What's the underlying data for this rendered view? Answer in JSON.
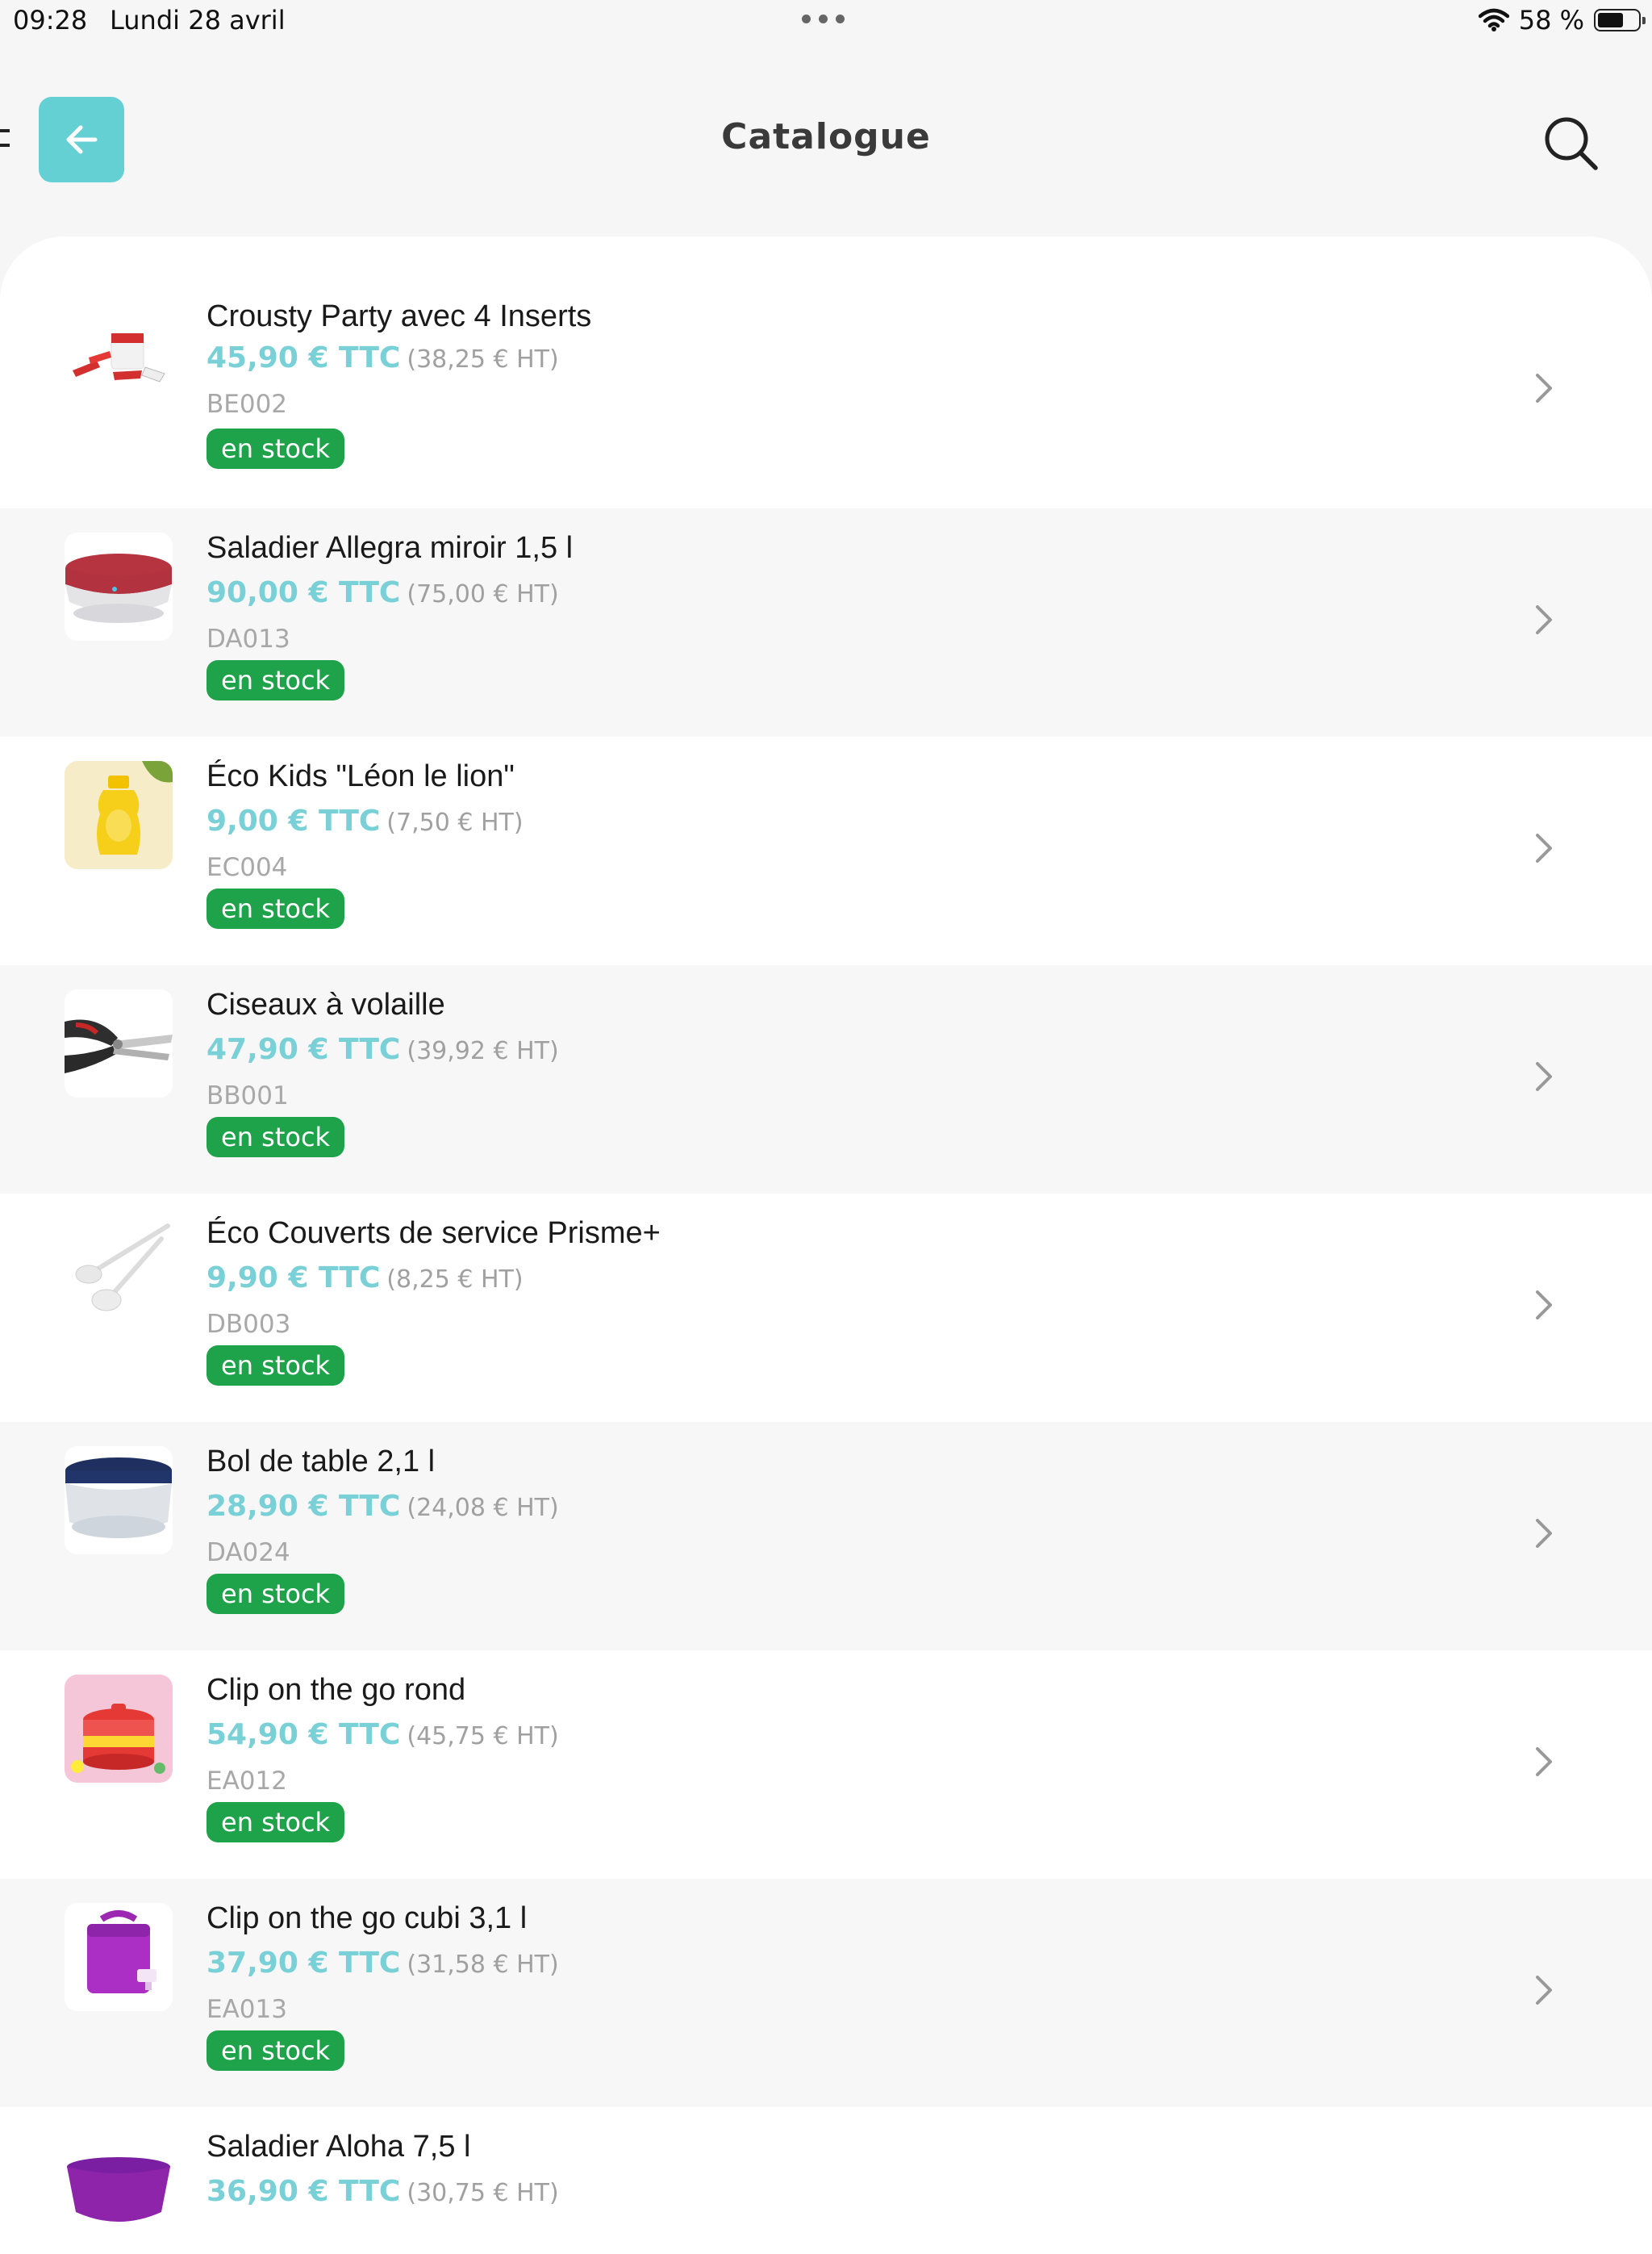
{
  "status_bar": {
    "time": "09:28",
    "date": "Lundi 28 avril",
    "battery_text": "58 %",
    "battery_level_percent": 58
  },
  "header": {
    "title": "Catalogue",
    "back_icon": "arrow-left-icon",
    "search_icon": "search-icon"
  },
  "colors": {
    "accent": "#65d0d4",
    "price": "#79d0d6",
    "stock_badge": "#1fa34a"
  },
  "products": [
    {
      "name": "Crousty Party avec 4 Inserts",
      "price_ttc": "45,90 € TTC",
      "price_ht": "(38,25 € HT)",
      "ref": "BE002",
      "stock": "en stock",
      "thumb_icon": "crousty-party-icon"
    },
    {
      "name": "Saladier Allegra miroir 1,5 l",
      "price_ttc": "90,00 € TTC",
      "price_ht": "(75,00 € HT)",
      "ref": "DA013",
      "stock": "en stock",
      "thumb_icon": "allegra-bowl-icon"
    },
    {
      "name": "Éco Kids \"Léon le lion\"",
      "price_ttc": "9,00 € TTC",
      "price_ht": "(7,50 € HT)",
      "ref": "EC004",
      "stock": "en stock",
      "thumb_icon": "kids-bottle-icon"
    },
    {
      "name": "Ciseaux à volaille",
      "price_ttc": "47,90 € TTC",
      "price_ht": "(39,92 € HT)",
      "ref": "BB001",
      "stock": "en stock",
      "thumb_icon": "scissors-icon"
    },
    {
      "name": "Éco Couverts de service Prisme+",
      "price_ttc": "9,90 € TTC",
      "price_ht": "(8,25 € HT)",
      "ref": "DB003",
      "stock": "en stock",
      "thumb_icon": "serving-spoons-icon"
    },
    {
      "name": "Bol de table 2,1 l",
      "price_ttc": "28,90 € TTC",
      "price_ht": "(24,08 € HT)",
      "ref": "DA024",
      "stock": "en stock",
      "thumb_icon": "table-bowl-icon"
    },
    {
      "name": "Clip on the go rond",
      "price_ttc": "54,90 € TTC",
      "price_ht": "(45,75 € HT)",
      "ref": "EA012",
      "stock": "en stock",
      "thumb_icon": "round-container-icon"
    },
    {
      "name": "Clip on the go cubi 3,1 l",
      "price_ttc": "37,90 € TTC",
      "price_ht": "(31,58 € HT)",
      "ref": "EA013",
      "stock": "en stock",
      "thumb_icon": "cubi-dispenser-icon"
    },
    {
      "name": "Saladier Aloha 7,5 l",
      "price_ttc": "36,90 € TTC",
      "price_ht": "(30,75 € HT)",
      "ref": "",
      "stock": "",
      "thumb_icon": "aloha-bowl-icon"
    }
  ]
}
